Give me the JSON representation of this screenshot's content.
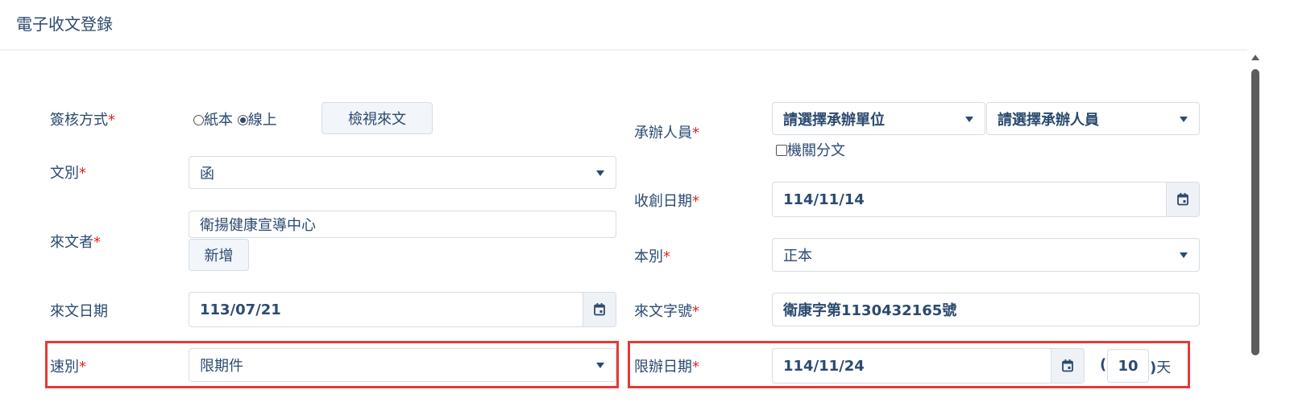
{
  "header": {
    "title": "電子收文登錄"
  },
  "required_mark": "*",
  "left": {
    "sign_method": {
      "label": "簽核方式",
      "option_paper": "紙本",
      "option_online": "線上",
      "selected": "線上",
      "view_button": "檢視來文"
    },
    "doc_type": {
      "label": "文別",
      "value": "函"
    },
    "sender": {
      "label": "來文者",
      "value": "衛揚健康宣導中心",
      "add_button": "新增"
    },
    "sent_date": {
      "label": "來文日期",
      "value": "113/07/21"
    },
    "speed": {
      "label": "速別",
      "value": "限期件"
    }
  },
  "right": {
    "handler": {
      "label": "承辦人員",
      "unit_placeholder": "請選擇承辦單位",
      "person_placeholder": "請選擇承辦人員",
      "agency_split_label": "機關分文"
    },
    "received_date": {
      "label": "收創日期",
      "value": "114/11/14"
    },
    "copy_type": {
      "label": "本別",
      "value": "正本"
    },
    "doc_number": {
      "label": "來文字號",
      "value": "衛康字第1130432165號"
    },
    "deadline": {
      "label": "限辦日期",
      "value": "114/11/24",
      "paren_open": "(",
      "days": "10",
      "paren_close": ")",
      "unit": "天"
    }
  },
  "colors": {
    "text": "#2b4a70",
    "required": "#e02424",
    "highlight": "#e53935"
  },
  "icons": {
    "calendar": "calendar-icon",
    "caret": "chevron-down-icon"
  }
}
